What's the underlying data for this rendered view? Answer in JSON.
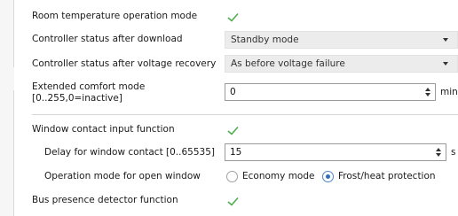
{
  "rows": {
    "room_temp_mode": {
      "label": "Room temperature operation mode",
      "checked": true
    },
    "ctrl_after_download": {
      "label": "Controller status after download",
      "value": "Standby mode"
    },
    "ctrl_after_voltage": {
      "label": "Controller status after voltage recovery",
      "value": "As before voltage failure"
    },
    "extended_comfort": {
      "label_line1": "Extended comfort mode",
      "label_line2": "[0..255,0=inactive]",
      "value": "0",
      "unit": "min"
    },
    "window_contact": {
      "label": "Window contact input function",
      "checked": true
    },
    "window_delay": {
      "label": "Delay for window contact [0..65535]",
      "value": "15",
      "unit": "s"
    },
    "open_window_mode": {
      "label": "Operation mode for open window",
      "option1": "Economy mode",
      "option2": "Frost/heat protection",
      "selected": "Frost/heat protection"
    },
    "bus_presence": {
      "label": "Bus presence detector function",
      "checked": true
    }
  },
  "colors": {
    "check": "#4caf50",
    "radio_selected": "#2f6fb8"
  }
}
